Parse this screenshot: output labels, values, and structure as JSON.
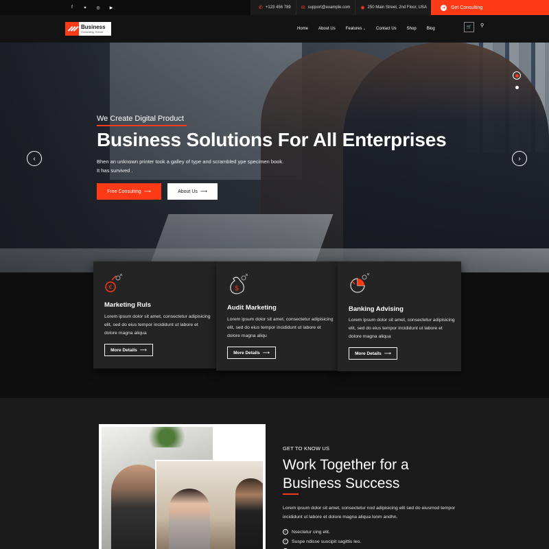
{
  "topbar": {
    "social": [
      {
        "icon": "facebook-icon",
        "glyph": "f"
      },
      {
        "icon": "twitter-icon",
        "glyph": "✦"
      },
      {
        "icon": "instagram-icon",
        "glyph": "◎"
      },
      {
        "icon": "youtube-icon",
        "glyph": "▶"
      }
    ],
    "phone": "+123 456 789",
    "email": "support@example.com",
    "address": "250 Main Street, 2nd Floor, USA",
    "cta": "Get Consulting"
  },
  "nav": {
    "logo_title": "Business",
    "logo_sub": "Consulting Theme",
    "items": [
      {
        "label": "Home",
        "dropdown": false
      },
      {
        "label": "About Us",
        "dropdown": false
      },
      {
        "label": "Features",
        "dropdown": true
      },
      {
        "label": "Contact Us",
        "dropdown": false
      },
      {
        "label": "Shop",
        "dropdown": false
      },
      {
        "label": "Blog",
        "dropdown": false
      }
    ]
  },
  "hero": {
    "eyebrow": "We Create Digital Product",
    "title": "Business Solutions For All Enterprises",
    "desc_line1": "Bhen an unknown printer took a galley of type and scrambled ype specimen book.",
    "desc_line2": "It has survived .",
    "primary_btn": "Free Consulting",
    "secondary_btn": "About Us",
    "prev_glyph": "‹",
    "next_glyph": "›"
  },
  "services": [
    {
      "icon": "euro-growth-icon",
      "title": "Marketing Ruls",
      "text": "Lorem ipsum dolor sit amet, consectetur adipisicing elit, sed do eius tempor incididunt ut labore et dolore magna aliqua",
      "button": "More Details"
    },
    {
      "icon": "money-bag-icon",
      "title": "Audit Marketing",
      "text": "Lorem ipsum dolor sit amet, consectetur adipisicing elit, sed do eius tempor incididunt ut labore et dolore magna aliqu",
      "button": "More Details"
    },
    {
      "icon": "pie-chart-icon",
      "title": "Banking Advising",
      "text": "Lorem ipsum dolor sit amet, consectetur adipisicing elit, sed do eius tempor incididunt ut labore et dolore magna aliqua",
      "button": "More Details"
    }
  ],
  "about": {
    "eyebrow": "GET TO KNOW US",
    "title_line1": "Work Together for a",
    "title_line2": "Business Success",
    "text": "Lorem ipsum dolor sit amet, consectetur nod adipisicing elit sed do eiusmod tempor incididunt ut labore et dolore magna aliqua lonm andhn.",
    "checks": [
      "Nsectetur cing elit.",
      "Suspe ndisse suscipit sagittis leo.",
      ""
    ]
  },
  "colors": {
    "accent": "#ff3a17",
    "background": "#121212",
    "card": "#242424"
  }
}
